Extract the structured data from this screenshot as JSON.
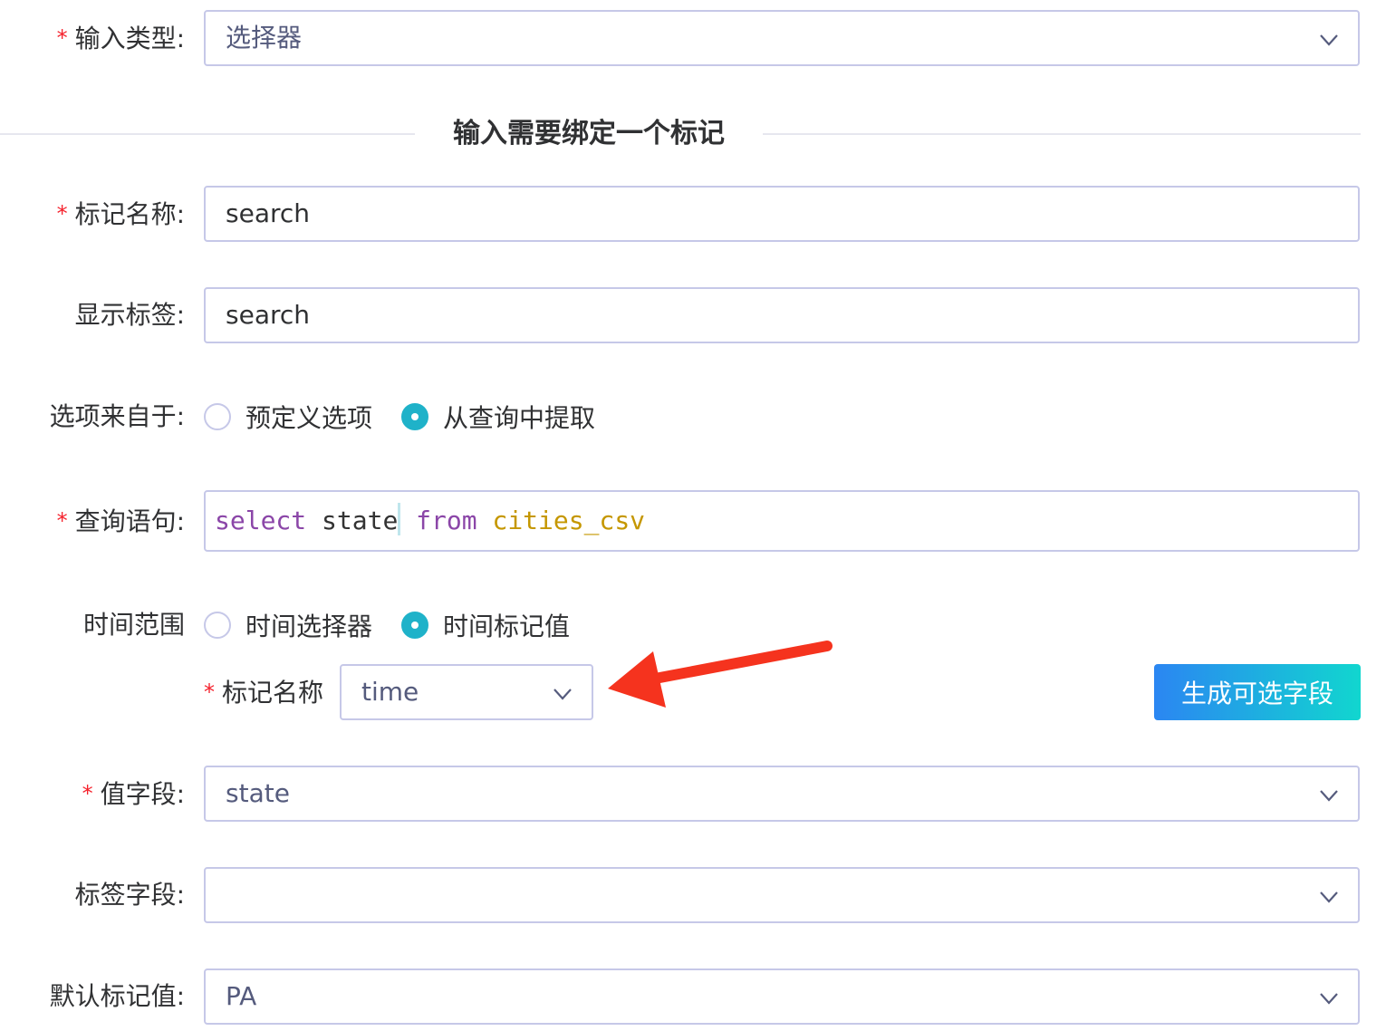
{
  "input_type": {
    "label": "输入类型:",
    "value": "选择器"
  },
  "divider": {
    "text": "输入需要绑定一个标记"
  },
  "mark_name": {
    "label": "标记名称:",
    "value": "search"
  },
  "display_label": {
    "label": "显示标签:",
    "value": "search"
  },
  "options_from": {
    "label": "选项来自于:",
    "options": [
      {
        "label": "预定义选项",
        "checked": false
      },
      {
        "label": "从查询中提取",
        "checked": true
      }
    ]
  },
  "query": {
    "label": "查询语句:",
    "tokens": {
      "kw1": "select",
      "col": "state",
      "kw2": "from",
      "table": "cities_csv"
    }
  },
  "time_range": {
    "label": "时间范围",
    "options": [
      {
        "label": "时间选择器",
        "checked": false
      },
      {
        "label": "时间标记值",
        "checked": true
      }
    ],
    "sub_label": "标记名称",
    "sub_value": "time",
    "generate_button": "生成可选字段"
  },
  "value_field": {
    "label": "值字段:",
    "value": "state"
  },
  "label_field": {
    "label": "标签字段:",
    "value": ""
  },
  "default_value": {
    "label": "默认标记值:",
    "value": "PA"
  },
  "colors": {
    "accent": "#1fb2c9",
    "required": "#f5222d",
    "arrow": "#f5331e"
  }
}
